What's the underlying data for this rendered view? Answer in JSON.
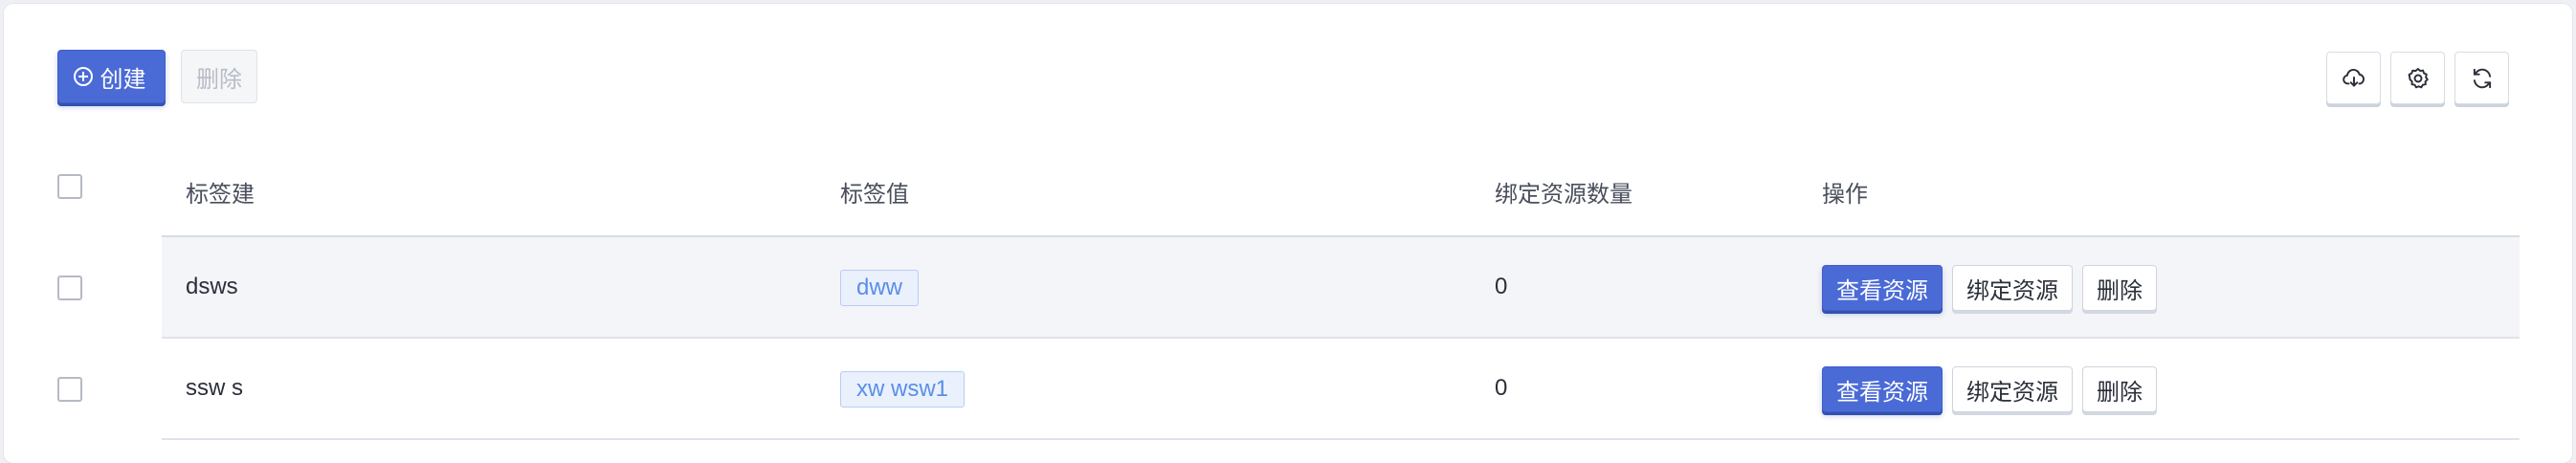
{
  "toolbar": {
    "create_label": "创建",
    "delete_label": "删除",
    "icons": [
      "cloud-download-icon",
      "gear-icon",
      "refresh-icon"
    ]
  },
  "table": {
    "columns": [
      "标签建",
      "标签值",
      "绑定资源数量",
      "操作"
    ],
    "rows": [
      {
        "key": "dsws",
        "value": "dww",
        "count": "0",
        "actions": [
          "查看资源",
          "绑定资源",
          "删除"
        ]
      },
      {
        "key": "ssw s",
        "value": "xw wsw1",
        "count": "0",
        "actions": [
          "查看资源",
          "绑定资源",
          "删除"
        ]
      }
    ]
  },
  "colors": {
    "primary": "#4a6ad6",
    "tag_bg": "#eaf1fd",
    "tag_text": "#5b8ee6",
    "row_bg": "#f4f5f8"
  }
}
